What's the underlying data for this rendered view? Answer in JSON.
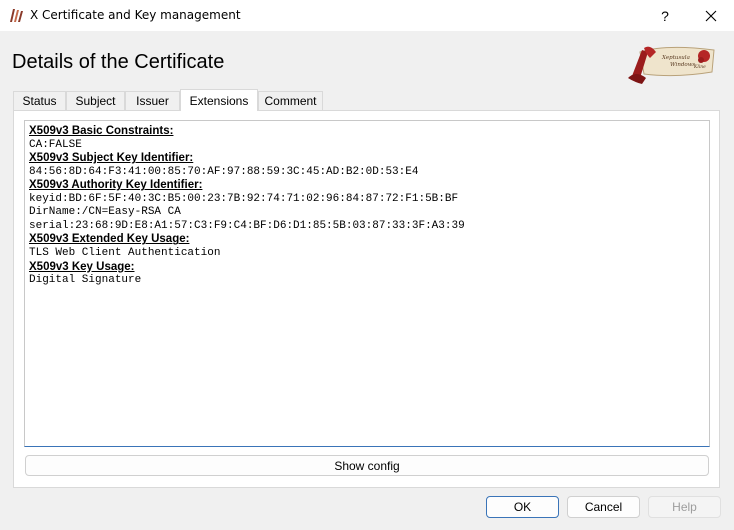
{
  "window": {
    "title": "X Certificate and Key management",
    "help_glyph": "?",
    "close_glyph": "✕"
  },
  "dialog": {
    "heading": "Details of the Certificate"
  },
  "logo": {
    "text_line1": "Xeptusula",
    "text_line2": "Windows",
    "text_line3": "Kline"
  },
  "tabs": [
    {
      "label": "Status",
      "active": false
    },
    {
      "label": "Subject",
      "active": false
    },
    {
      "label": "Issuer",
      "active": false
    },
    {
      "label": "Extensions",
      "active": true
    },
    {
      "label": "Comment",
      "active": false
    }
  ],
  "extensions": [
    {
      "title": "X509v3 Basic Constraints:",
      "lines": [
        "CA:FALSE"
      ]
    },
    {
      "title": "X509v3 Subject Key Identifier:",
      "lines": [
        "84:56:8D:64:F3:41:00:85:70:AF:97:88:59:3C:45:AD:B2:0D:53:E4"
      ]
    },
    {
      "title": "X509v3 Authority Key Identifier:",
      "lines": [
        "keyid:BD:6F:5F:40:3C:B5:00:23:7B:92:74:71:02:96:84:87:72:F1:5B:BF",
        "DirName:/CN=Easy-RSA CA",
        "serial:23:68:9D:E8:A1:57:C3:F9:C4:BF:D6:D1:85:5B:03:87:33:3F:A3:39"
      ]
    },
    {
      "title": "X509v3 Extended Key Usage:",
      "lines": [
        "TLS Web Client Authentication"
      ]
    },
    {
      "title": "X509v3 Key Usage:",
      "lines": [
        "Digital Signature"
      ]
    }
  ],
  "buttons": {
    "show_config": "Show config",
    "ok": "OK",
    "cancel": "Cancel",
    "help": "Help"
  },
  "colors": {
    "accent": "#3a74b8",
    "window_bg": "#f0f0f0",
    "panel_bg": "#ffffff",
    "disabled_text": "#9d9d9d",
    "logo_red": "#9b1c1c",
    "logo_parchment": "#efe4cc"
  }
}
